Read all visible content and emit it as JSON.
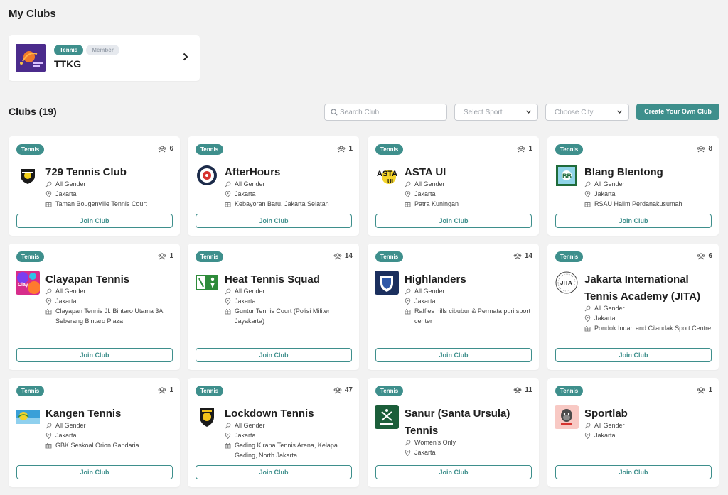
{
  "header": {
    "title": "My Clubs"
  },
  "my_club": {
    "sport": "Tennis",
    "role": "Member",
    "name": "TTKG"
  },
  "clubs_section": {
    "title": "Clubs (19)",
    "search_placeholder": "Search Club",
    "sport_select": "Select Sport",
    "city_select": "Choose City",
    "create_label": "Create Your Own Club"
  },
  "join_label": "Join Club",
  "colors": {
    "accent": "#3e8f8c"
  },
  "clubs": [
    {
      "sport": "Tennis",
      "members": "6",
      "name": "729 Tennis Club",
      "gender": "All Gender",
      "city": "Jakarta",
      "venue": "Taman Bougenville Tennis Court",
      "logo_icon": "729-badge-logo"
    },
    {
      "sport": "Tennis",
      "members": "1",
      "name": "AfterHours",
      "gender": "All Gender",
      "city": "Jakarta",
      "venue": "Kebayoran Baru, Jakarta Selatan",
      "logo_icon": "afterhours-round-logo"
    },
    {
      "sport": "Tennis",
      "members": "1",
      "name": "ASTA UI",
      "gender": "All Gender",
      "city": "Jakarta",
      "venue": "Patra Kuningan",
      "logo_icon": "asta-ui-logo"
    },
    {
      "sport": "Tennis",
      "members": "8",
      "name": "Blang Blentong",
      "gender": "All Gender",
      "city": "Jakarta",
      "venue": "RSAU Halim Perdanakusumah",
      "logo_icon": "blang-blentong-logo"
    },
    {
      "sport": "Tennis",
      "members": "1",
      "name": "Clayapan Tennis",
      "gender": "All Gender",
      "city": "Jakarta",
      "venue": "Clayapan Tennis Jl. Bintaro Utama 3A Seberang Bintaro Plaza",
      "logo_icon": "clayapan-logo"
    },
    {
      "sport": "Tennis",
      "members": "14",
      "name": "Heat Tennis Squad",
      "gender": "All Gender",
      "city": "Jakarta",
      "venue": "Guntur Tennis Court (Polisi Militer Jayakarta)",
      "logo_icon": "heat-tennis-logo"
    },
    {
      "sport": "Tennis",
      "members": "14",
      "name": "Highlanders",
      "gender": "All Gender",
      "city": "Jakarta",
      "venue": "Raffles hills cibubur & Permata puri sport center",
      "logo_icon": "highlanders-shield-logo"
    },
    {
      "sport": "Tennis",
      "members": "6",
      "name": "Jakarta International Tennis Academy (JITA)",
      "gender": "All Gender",
      "city": "Jakarta",
      "venue": "Pondok Indah and Cilandak Sport Centre",
      "logo_icon": "jita-logo"
    },
    {
      "sport": "Tennis",
      "members": "1",
      "name": "Kangen Tennis",
      "gender": "All Gender",
      "city": "Jakarta",
      "venue": "GBK Seskoal Orion Gandaria",
      "logo_icon": "kangen-logo"
    },
    {
      "sport": "Tennis",
      "members": "47",
      "name": "Lockdown Tennis",
      "gender": "All Gender",
      "city": "Jakarta",
      "venue": "Gading Kirana Tennis Arena, Kelapa Gading, North Jakarta",
      "logo_icon": "lockdown-badge-logo"
    },
    {
      "sport": "Tennis",
      "members": "11",
      "name": "Sanur (Santa Ursula) Tennis",
      "gender": "Women's Only",
      "city": "Jakarta",
      "venue": "",
      "logo_icon": "sanur-logo"
    },
    {
      "sport": "Tennis",
      "members": "1",
      "name": "Sportlab",
      "gender": "All Gender",
      "city": "Jakarta",
      "venue": "",
      "logo_icon": "sportlab-gorilla-logo"
    }
  ]
}
